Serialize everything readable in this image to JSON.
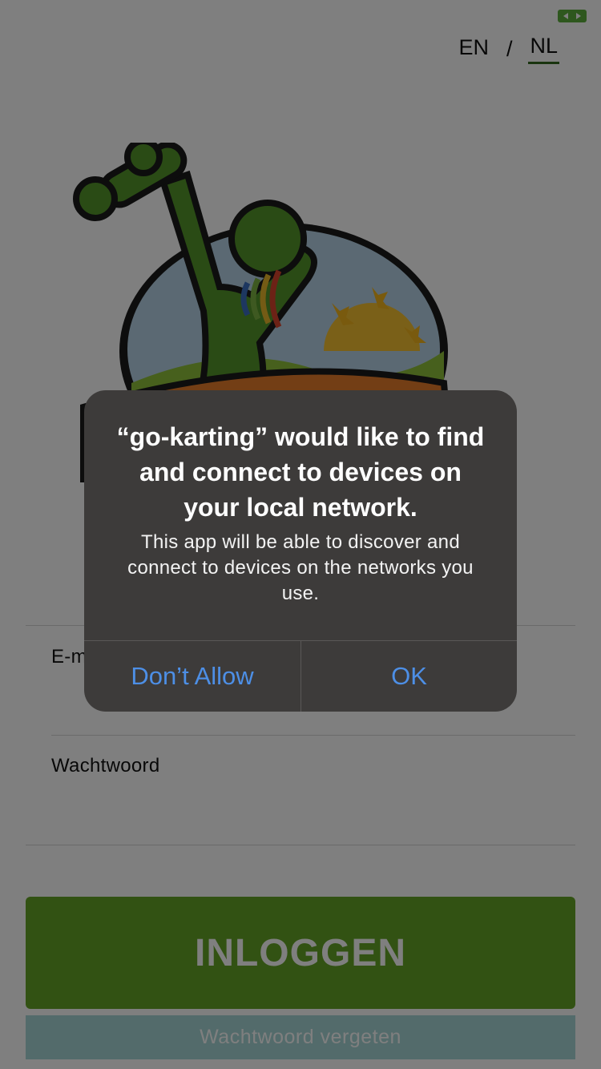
{
  "header": {
    "languages": [
      {
        "label": "EN",
        "active": false
      },
      {
        "label": "NL",
        "active": true
      }
    ],
    "separator": "/"
  },
  "form": {
    "email_label": "E-mail",
    "password_label": "Wachtwoord",
    "login_button": "INLOGGEN",
    "forgot_link": "Wachtwoord vergeten"
  },
  "alert": {
    "title": "“go-karting” would like to find and connect to devices on your local network.",
    "message": "This app will be able to discover and connect to devices on the networks you use.",
    "deny_label": "Don’t Allow",
    "ok_label": "OK"
  },
  "colors": {
    "brand_green": "#64a526",
    "link_blue": "#4d8fe6",
    "alert_bg": "#3d3b3a"
  },
  "icons": {
    "status": "expand-arrows-icon",
    "logo": "mascot-logo"
  }
}
